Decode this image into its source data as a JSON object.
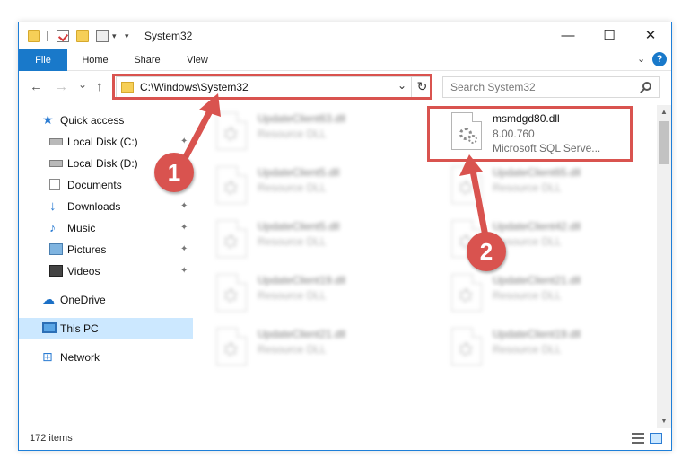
{
  "window": {
    "title": "System32",
    "controls": {
      "minimize": "—",
      "maximize": "☐",
      "close": "✕"
    }
  },
  "ribbon": {
    "tabs": [
      {
        "label": "File"
      },
      {
        "label": "Home"
      },
      {
        "label": "Share"
      },
      {
        "label": "View"
      }
    ],
    "help": "?"
  },
  "navigation": {
    "back": "←",
    "forward": "→",
    "recent": "⌄",
    "up": "↑",
    "address_path": "C:\\Windows\\System32",
    "address_dropdown": "⌄",
    "refresh": "↻",
    "search_placeholder": "Search System32"
  },
  "sidebar": {
    "items": [
      {
        "label": "Quick access",
        "icon": "quick-access-star-icon"
      },
      {
        "label": "Local Disk (C:)",
        "icon": "local-disk-icon",
        "pinned": true
      },
      {
        "label": "Local Disk (D:)",
        "icon": "local-disk-icon",
        "pinned": true
      },
      {
        "label": "Documents",
        "icon": "documents-icon",
        "pinned": true
      },
      {
        "label": "Downloads",
        "icon": "downloads-icon",
        "pinned": true
      },
      {
        "label": "Music",
        "icon": "music-icon",
        "pinned": true
      },
      {
        "label": "Pictures",
        "icon": "pictures-icon",
        "pinned": true
      },
      {
        "label": "Videos",
        "icon": "videos-icon",
        "pinned": true
      },
      {
        "label": "OneDrive",
        "icon": "onedrive-cloud-icon"
      },
      {
        "label": "This PC",
        "icon": "this-pc-icon",
        "selected": true
      },
      {
        "label": "Network",
        "icon": "network-icon"
      }
    ],
    "pin_glyph": "📌"
  },
  "files": {
    "highlighted": {
      "name": "msmdgd80.dll",
      "version": "8.00.760",
      "description": "Microsoft SQL Serve..."
    },
    "blurred_left": [
      {
        "name": "UpdateClient63.dll",
        "type": "Resource DLL"
      },
      {
        "name": "UpdateClient5.dll",
        "type": "Resource DLL"
      },
      {
        "name": "UpdateClient5.dll",
        "type": "Resource DLL"
      },
      {
        "name": "UpdateClient19.dll",
        "type": "Resource DLL"
      },
      {
        "name": "UpdateClient21.dll",
        "type": "Resource DLL"
      }
    ],
    "blurred_right": [
      {
        "name": "UpdateClient65.dll",
        "type": "Resource DLL"
      },
      {
        "name": "UpdateClient42.dll",
        "type": "Resource DLL"
      },
      {
        "name": "UpdateClient21.dll",
        "type": "Resource DLL"
      },
      {
        "name": "UpdateClient19.dll",
        "type": "Resource DLL"
      }
    ]
  },
  "status": {
    "item_count": "172 items"
  },
  "annotations": {
    "step1": "1",
    "step2": "2",
    "color": "#d9534f"
  }
}
